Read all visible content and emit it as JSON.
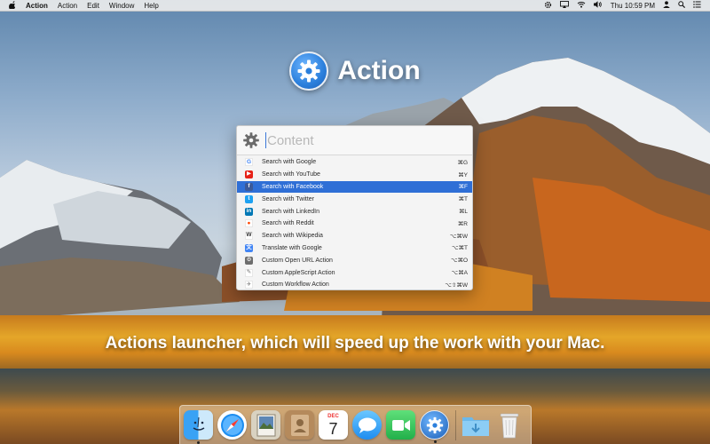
{
  "menubar": {
    "apple_icon": "apple-logo",
    "app_name": "Action",
    "menus": [
      "Action",
      "Edit",
      "Window",
      "Help"
    ],
    "status_clock": "Thu 10:59 PM"
  },
  "hero": {
    "title": "Action",
    "icon": "gear-icon"
  },
  "launcher": {
    "search_placeholder": "Content",
    "search_value": "",
    "items": [
      {
        "label": "Search with Google",
        "shortcut": "⌘G",
        "icon": "google-icon",
        "color": "#ffffff",
        "glyph": "G",
        "glyph_color": "#4285f4",
        "selected": false
      },
      {
        "label": "Search with YouTube",
        "shortcut": "⌘Y",
        "icon": "youtube-icon",
        "color": "#e62117",
        "glyph": "▶",
        "glyph_color": "#ffffff",
        "selected": false
      },
      {
        "label": "Search with Facebook",
        "shortcut": "⌘F",
        "icon": "facebook-icon",
        "color": "#3b5998",
        "glyph": "f",
        "glyph_color": "#ffffff",
        "selected": true
      },
      {
        "label": "Search with Twitter",
        "shortcut": "⌘T",
        "icon": "twitter-icon",
        "color": "#1da1f2",
        "glyph": "t",
        "glyph_color": "#ffffff",
        "selected": false
      },
      {
        "label": "Search with LinkedIn",
        "shortcut": "⌘L",
        "icon": "linkedin-icon",
        "color": "#0077b5",
        "glyph": "in",
        "glyph_color": "#ffffff",
        "selected": false
      },
      {
        "label": "Search with Reddit",
        "shortcut": "⌘R",
        "icon": "reddit-icon",
        "color": "#ffffff",
        "glyph": "●",
        "glyph_color": "#ff4500",
        "selected": false
      },
      {
        "label": "Search with Wikipedia",
        "shortcut": "⌥⌘W",
        "icon": "wikipedia-icon",
        "color": "#ffffff",
        "glyph": "W",
        "glyph_color": "#333333",
        "selected": false
      },
      {
        "label": "Translate with Google",
        "shortcut": "⌥⌘T",
        "icon": "google-translate-icon",
        "color": "#4285f4",
        "glyph": "文",
        "glyph_color": "#ffffff",
        "selected": false
      },
      {
        "label": "Custom Open URL Action",
        "shortcut": "⌥⌘O",
        "icon": "gear-icon",
        "color": "#6d6d6d",
        "glyph": "⚙",
        "glyph_color": "#ffffff",
        "selected": false
      },
      {
        "label": "Custom AppleScript Action",
        "shortcut": "⌥⌘A",
        "icon": "applescript-icon",
        "color": "#ffffff",
        "glyph": "✎",
        "glyph_color": "#777777",
        "selected": false
      },
      {
        "label": "Custom Workflow Action",
        "shortcut": "⌥⇧⌘W",
        "icon": "automator-icon",
        "color": "#ffffff",
        "glyph": "✈",
        "glyph_color": "#777777",
        "selected": false
      }
    ]
  },
  "tagline": "Actions launcher, which will speed up the work with your Mac.",
  "dock": {
    "apps": [
      {
        "icon": "finder-icon",
        "running": true
      },
      {
        "icon": "safari-icon",
        "running": false
      },
      {
        "icon": "preview-icon",
        "running": false
      },
      {
        "icon": "contacts-icon",
        "running": false
      },
      {
        "icon": "calendar-icon",
        "running": false,
        "month": "DEC",
        "day": "7"
      },
      {
        "icon": "messages-icon",
        "running": false
      },
      {
        "icon": "facetime-icon",
        "running": false
      },
      {
        "icon": "action-app-icon",
        "running": true
      }
    ],
    "stacks": [
      {
        "icon": "downloads-folder-icon"
      },
      {
        "icon": "trash-icon"
      }
    ]
  },
  "colors": {
    "accent": "#2f6fd6",
    "action_blue": "#2b7fdc"
  }
}
